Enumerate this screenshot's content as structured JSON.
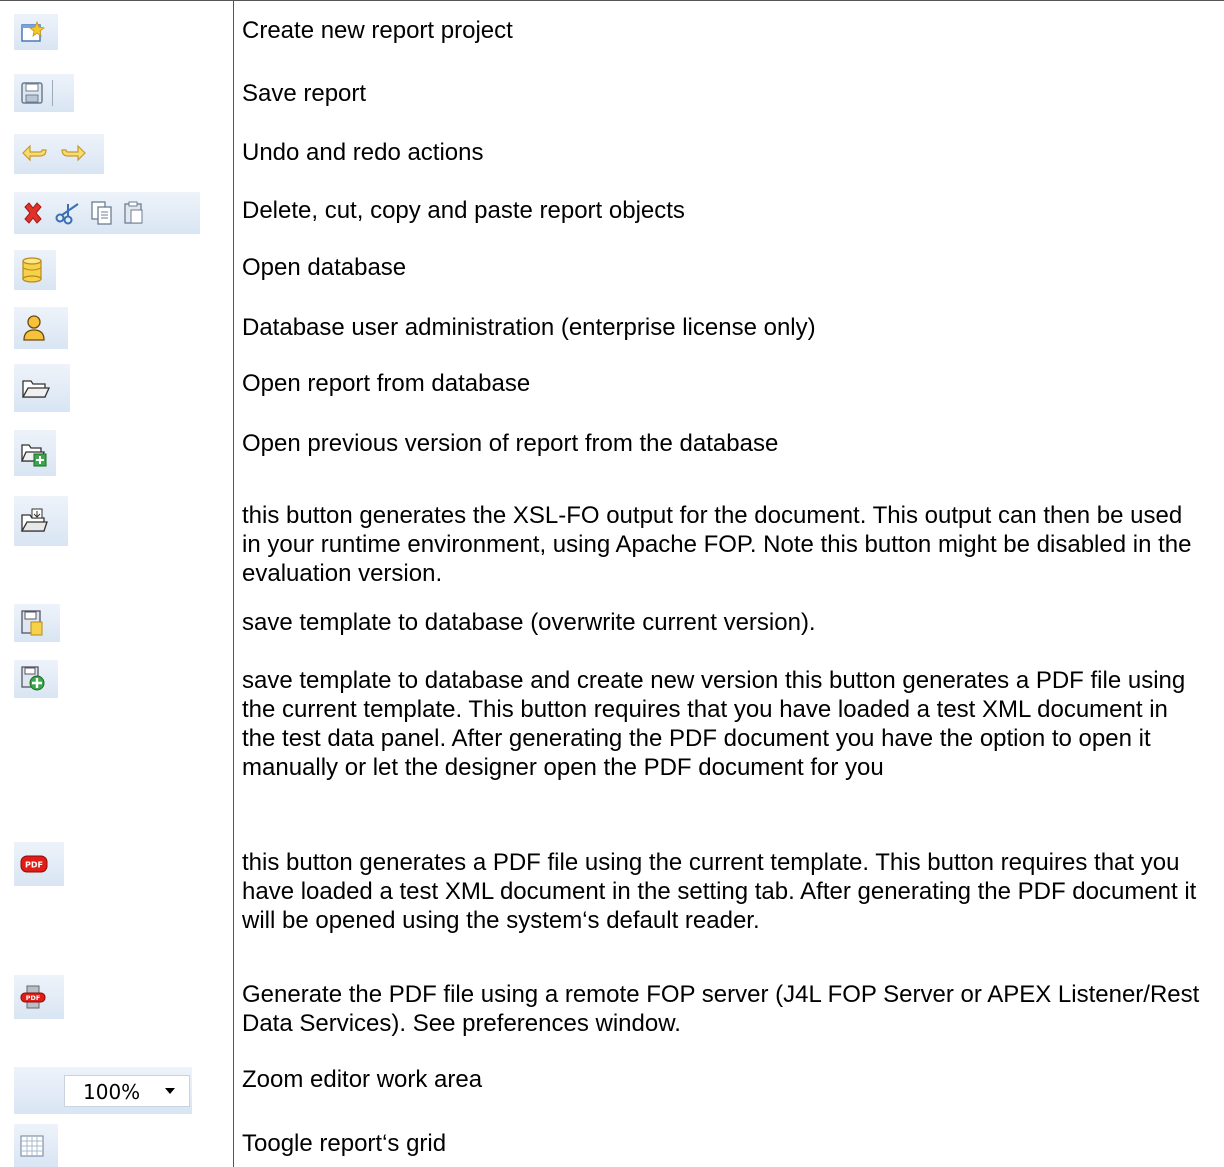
{
  "rows": [
    {
      "icon": "new-project-icon",
      "text": "Create new report project"
    },
    {
      "icon": "save-icon",
      "text": "Save report"
    },
    {
      "icon": "undo-redo-icons",
      "text": "Undo and redo actions"
    },
    {
      "icon": "edit-icons",
      "text": "Delete, cut, copy and paste report objects"
    },
    {
      "icon": "database-icon",
      "text": "Open database"
    },
    {
      "icon": "user-admin-icon",
      "text": "Database user administration (enterprise license only)"
    },
    {
      "icon": "open-folder-icon",
      "text": "Open report from database"
    },
    {
      "icon": "open-version-icon",
      "text": "Open previous version of report from the database"
    },
    {
      "icon": "fo-output-icon",
      "text": "this button generates the XSL-FO output for the document. This output can then be used in your runtime environment, using Apache FOP. Note this button might be disabled in the evaluation version."
    },
    {
      "icon": "save-db-icon",
      "text": "save template to database (overwrite current version)."
    },
    {
      "icon": "save-db-new-version-icon",
      "text": "save template to database and create new version this button generates a PDF file using the current template. This button requires that you have loaded a test XML document in the test data panel. After generating the PDF document you have the option to open it manually or let the designer open the PDF document for you"
    },
    {
      "icon": "pdf-icon",
      "text": "this button generates a PDF file using the current template. This button requires that you have loaded a test XML document in the setting tab. After generating the PDF document  it will be opened using the system‘s default reader."
    },
    {
      "icon": "remote-pdf-icon",
      "text": "Generate the PDF file using a remote FOP server (J4L FOP Server or APEX Listener/Rest Data Services). See preferences window."
    },
    {
      "icon": "zoom-select",
      "text": "Zoom editor work area"
    },
    {
      "icon": "grid-icon",
      "text": "Toogle report‘s grid"
    }
  ],
  "zoom": {
    "value": "100%"
  }
}
